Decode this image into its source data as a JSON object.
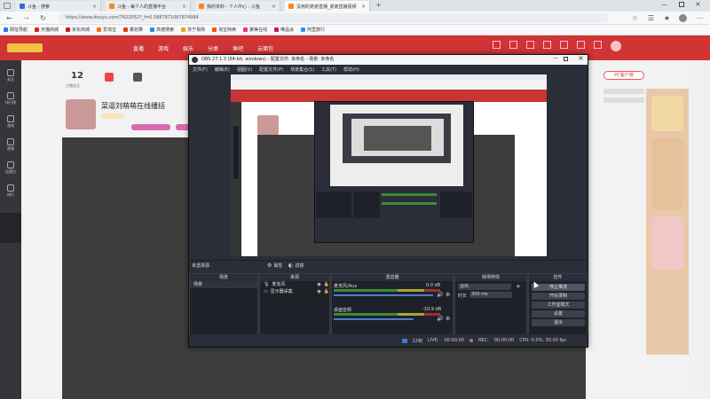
{
  "tabs": [
    {
      "label": "斗鱼 - 搜索",
      "color": "#2b6fd4",
      "active": false
    },
    {
      "label": "斗鱼 - 每个人的直播平台",
      "color": "#f08b1b",
      "active": false
    },
    {
      "label": "我的资料 - 个人中心 - 斗鱼",
      "color": "#f08b1b",
      "active": false
    },
    {
      "label": "没用的弟弟直播_弟弟直播视频 -",
      "color": "#f08b1b",
      "active": true
    }
  ],
  "address": {
    "url": "https://www.douyu.com/7822052?_f=0.5887971067874984"
  },
  "bookmarks": [
    {
      "label": "网址导航",
      "color": "#2b7be0"
    },
    {
      "label": "天猫商城",
      "color": "#e02020"
    },
    {
      "label": "京东商城",
      "color": "#d01818"
    },
    {
      "label": "爱淘宝",
      "color": "#ff6a00"
    },
    {
      "label": "聚划算",
      "color": "#e63a1c"
    },
    {
      "label": "高德搜索",
      "color": "#2a8be0"
    },
    {
      "label": "苏宁易购",
      "color": "#f1a400"
    },
    {
      "label": "淘宝特卖",
      "color": "#ff5000"
    },
    {
      "label": "聚美在线",
      "color": "#e53b77"
    },
    {
      "label": "唯品会",
      "color": "#c8166f"
    },
    {
      "label": "阿里旅行",
      "color": "#2d91f0"
    }
  ],
  "site": {
    "nav": [
      "直播",
      "游戏",
      "娱乐",
      "分类",
      "鱼吧",
      "云面包"
    ],
    "follow_count": "12",
    "follow_label": "主播关注",
    "streamer_title": "菜逼刘萌萌在线播括",
    "pc_client": "PC客户端",
    "sidebar": [
      "关注",
      "排行榜",
      "游戏",
      "视频",
      "运营位",
      "排行"
    ]
  },
  "obs": {
    "title": "OBS 27.1.3 (64-bit, windows) - 配置文件: 未命名 - 场景: 未命名",
    "menu": [
      "文件(F)",
      "编辑(E)",
      "视图(V)",
      "配置文件(P)",
      "场景集合(S)",
      "工具(T)",
      "帮助(H)"
    ],
    "no_source": "未选择源",
    "props_btn": "属性",
    "filters_btn": "滤镜",
    "panels": {
      "scenes": "场景",
      "sources": "来源",
      "mixer": "混音器",
      "transitions": "转场特效",
      "controls": "控件"
    },
    "scene_items": [
      "场景"
    ],
    "source_items": [
      "麦克风",
      "显示器采集"
    ],
    "mixer_tracks": [
      {
        "name": "麦克风/Aux",
        "db": "0.0 dB"
      },
      {
        "name": "桌面音频",
        "db": "-10.9 dB"
      }
    ],
    "transition": {
      "type": "淡出",
      "duration_label": "时长",
      "duration": "300 ms"
    },
    "control_buttons": [
      "停止推流",
      "开始录制",
      "工作室模式",
      "设置",
      "退出"
    ],
    "status": {
      "dropped": "12帧",
      "live_label": "LIVE:",
      "live_time": "00:00:00",
      "rec_label": "REC:",
      "rec_time": "00:00:00",
      "cpu": "CPU: 0.0%, 30.00 fps"
    }
  }
}
